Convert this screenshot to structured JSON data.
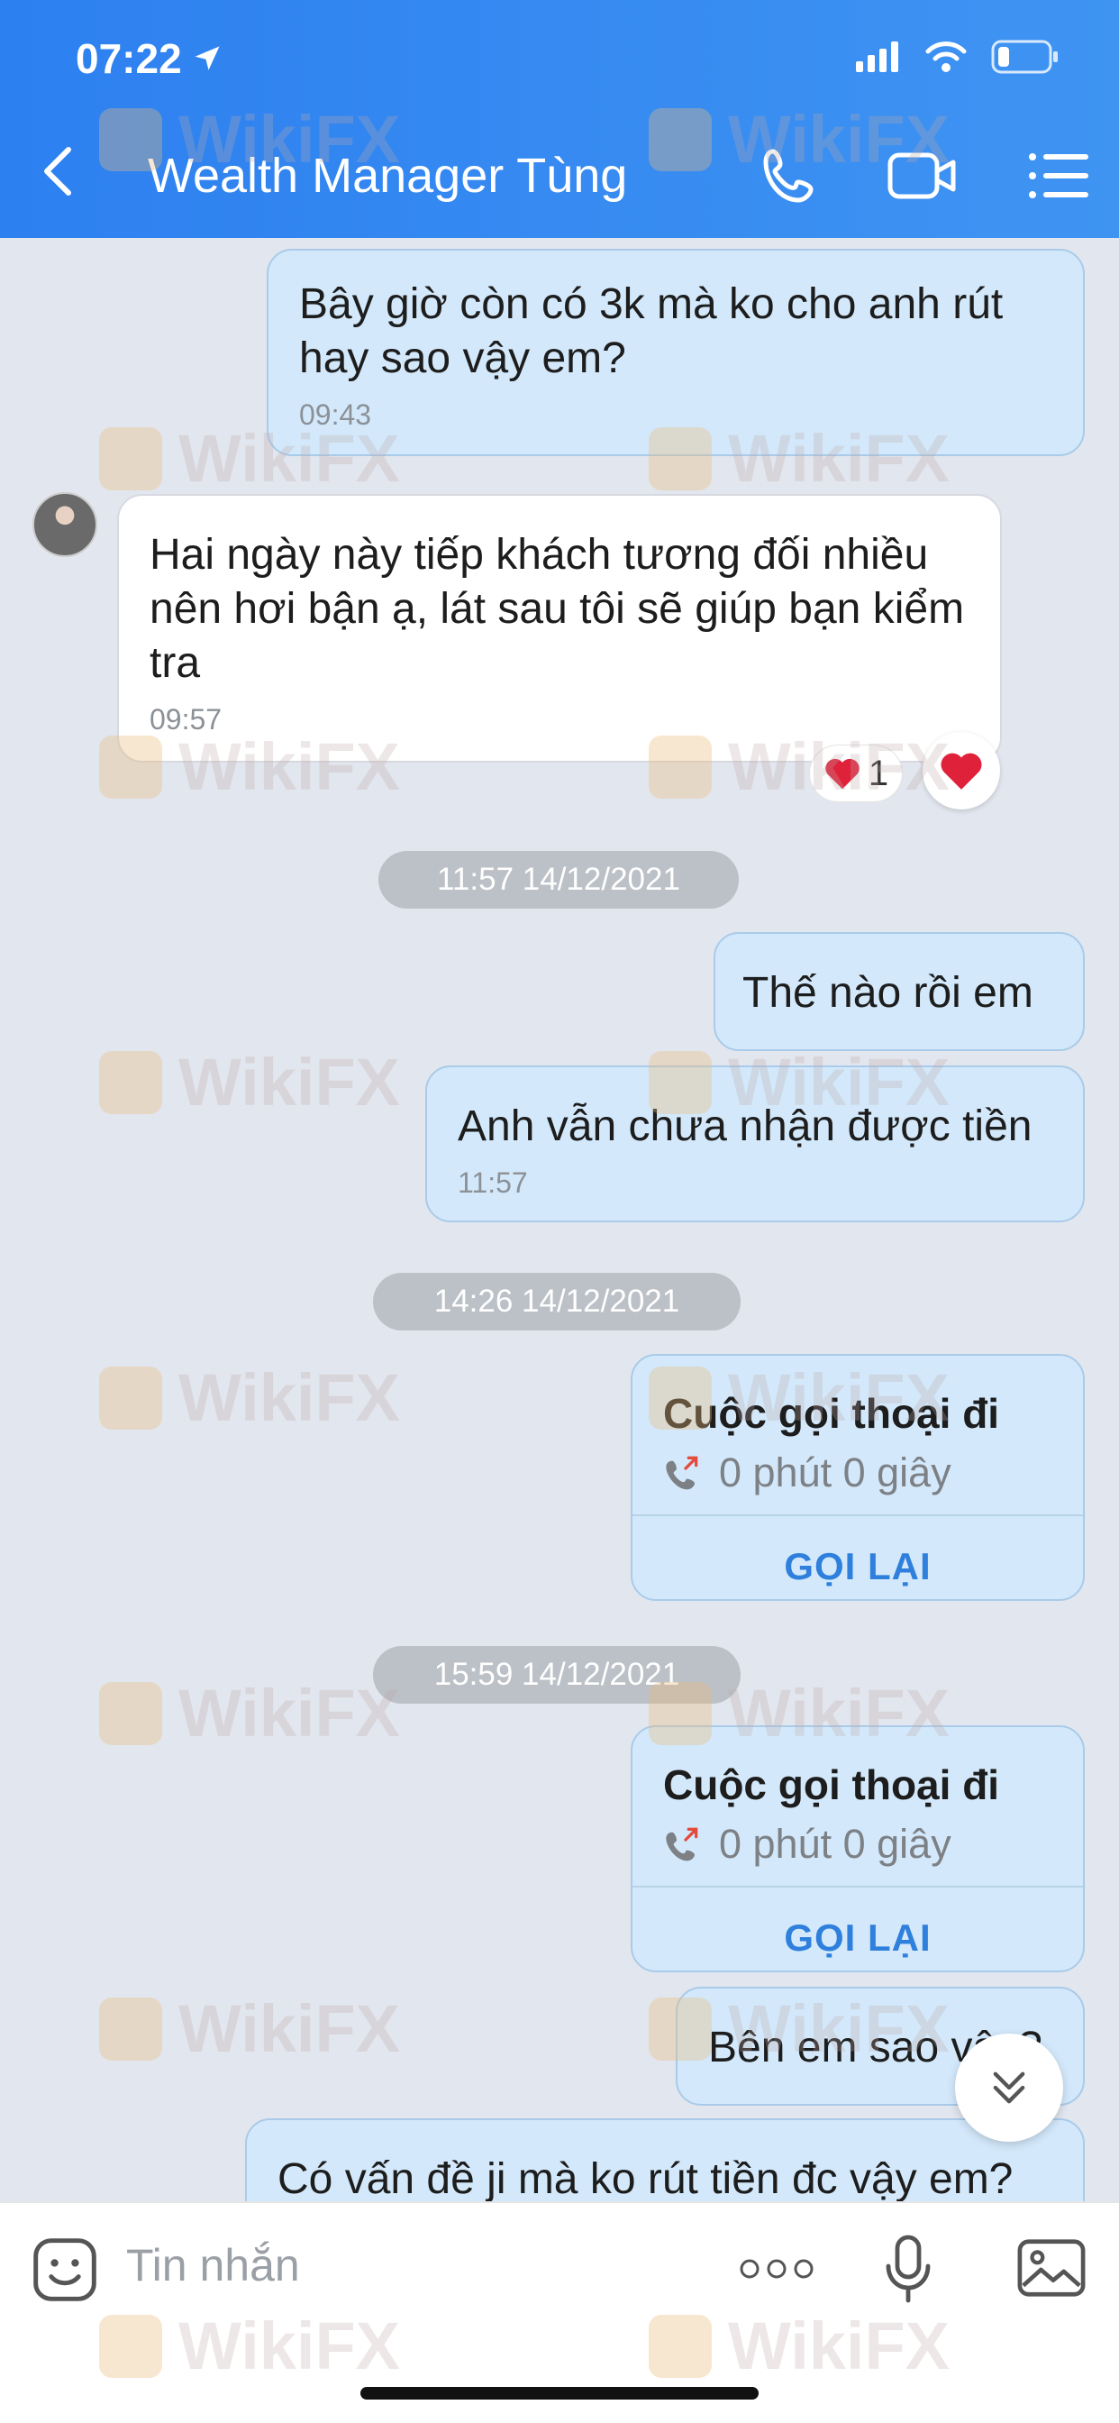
{
  "status_bar": {
    "time": "07:22"
  },
  "header": {
    "title": "Wealth Manager Tùng"
  },
  "watermark": {
    "text": "WikiFX"
  },
  "messages": [
    {
      "text": "Bây giờ còn có 3k mà ko cho anh rút hay sao vậy em?",
      "time": "09:43"
    },
    {
      "text": "Hai ngày này tiếp khách tương đối nhiều nên hơi bận ạ, lát sau tôi sẽ giúp bạn kiểm tra",
      "time": "09:57",
      "reaction_count": "1"
    },
    {
      "date": "11:57 14/12/2021"
    },
    {
      "text": "Thế nào rồi em"
    },
    {
      "text": "Anh vẫn chưa nhận được tiền",
      "time": "11:57"
    },
    {
      "date": "14:26 14/12/2021"
    },
    {
      "call_title": "Cuộc gọi thoại đi",
      "call_duration": "0 phút 0 giây",
      "call_action": "GỌI LẠI"
    },
    {
      "date": "15:59 14/12/2021"
    },
    {
      "call_title": "Cuộc gọi thoại đi",
      "call_duration": "0 phút 0 giây",
      "call_action": "GỌI LẠI"
    },
    {
      "text": "Bên em sao vậy?"
    },
    {
      "text": "Có vấn đề ji mà ko rút tiền đc vậy em?"
    }
  ],
  "input": {
    "placeholder": "Tin nhắn"
  },
  "colors": {
    "header": "#3a8ef2",
    "outgoing_bubble": "#d3e9fb",
    "incoming_bubble": "#ffffff",
    "chat_bg": "#e2e6ee",
    "accent": "#2f7fdd"
  }
}
